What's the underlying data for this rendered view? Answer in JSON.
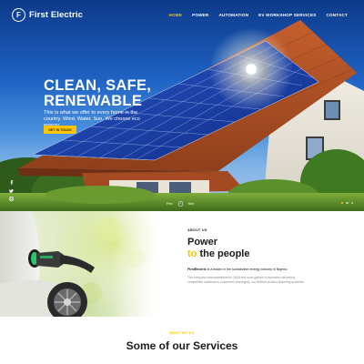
{
  "header": {
    "logo_text": "First Electric",
    "logo_letter": "F",
    "nav": [
      {
        "label": "Home",
        "active": true
      },
      {
        "label": "Power",
        "active": false
      },
      {
        "label": "Automation",
        "active": false
      },
      {
        "label": "EV Workshop Services",
        "active": false
      },
      {
        "label": "Contact",
        "active": false
      }
    ]
  },
  "hero": {
    "title_lines": [
      "Clean, Safe,",
      "Renewable"
    ],
    "text": "This is what we offer to every home in the country. Wind, Water, Sun. We choose eco energy",
    "button_label": "Get in touch",
    "slider_prev": "Prev",
    "slider_next": "Next",
    "slide_count": 3,
    "active_slide": 1
  },
  "social": {
    "icons": [
      "facebook-icon",
      "twitter-icon",
      "instagram-icon"
    ]
  },
  "about": {
    "eyebrow": "About us",
    "heading_line1": "Power",
    "heading_accent": "to",
    "heading_rest": "the people",
    "lead_brand": "FirstElectric",
    "lead_rest": "is a leader in the sustainable energy industry in Nigeria.",
    "body": "The company was established in 2018 and soon gained a reputation delivering competitive solutions to customers thoroughly, our flexible product financing schemes."
  },
  "services": {
    "eyebrow": "What we do",
    "title": "Some of our Services"
  },
  "colors": {
    "accent": "#ffc400",
    "sky_top": "#0d3a8a",
    "roof": "#b0532a",
    "panel": "#1a3ea8",
    "text_dark": "#1b1b1b"
  }
}
